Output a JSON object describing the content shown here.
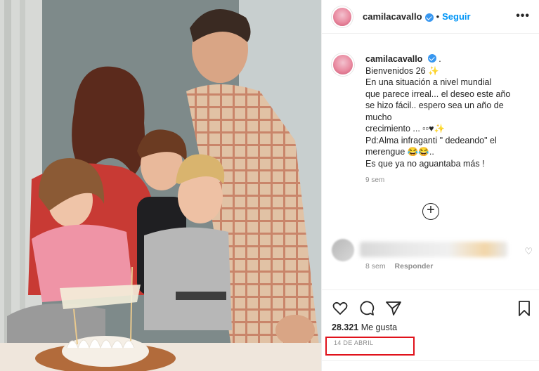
{
  "post": {
    "username": "camilacavallo",
    "dot": "•",
    "follow_label": "Seguir",
    "more_label": "•••"
  },
  "caption": {
    "username": "camilacavallo",
    "lines": [
      "Bienvenidos 26 ✨",
      "En una situación a nivel mundial",
      "que parece irreal... el deseo este año",
      "se hizo fácil.. espero sea un año de",
      "mucho",
      "crecimiento ... ▫▫♥✨",
      "Pd:Alma infraganti \" dedeando\" el",
      "merengue 😂😂..",
      "Es que ya no aguantaba más !"
    ],
    "time": "9 sem"
  },
  "load_more": {
    "label": "+"
  },
  "comment": {
    "time": "8 sem",
    "reply_label": "Responder"
  },
  "footer": {
    "likes_count": "28.321",
    "likes_label": "Me gusta",
    "date": "14 DE ABRIL"
  },
  "colors": {
    "accent": "#0095f6",
    "highlight": "#e0121b",
    "text": "#262626",
    "muted": "#8e8e8e"
  },
  "icons": [
    "heart-icon",
    "comment-icon",
    "share-icon",
    "bookmark-icon",
    "verified-icon",
    "more-icon",
    "plus-circle-icon"
  ]
}
